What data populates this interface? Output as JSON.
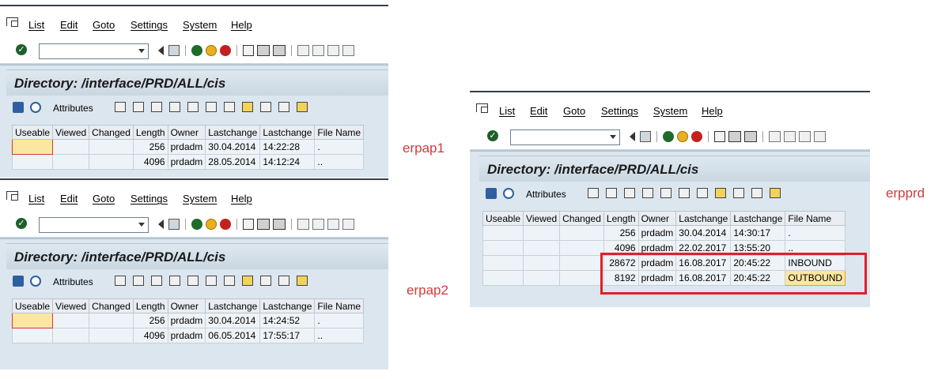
{
  "menu": [
    "List",
    "Edit",
    "Goto",
    "Settings",
    "System",
    "Help"
  ],
  "attributes_label": "Attributes",
  "columns": [
    "Useable",
    "Viewed",
    "Changed",
    "Length",
    "Owner",
    "Lastchange",
    "Lastchange",
    "File Name"
  ],
  "erpap1": {
    "label": "erpap1",
    "title": "Directory: /interface/PRD/ALL/cis",
    "rows": [
      {
        "length": "256",
        "owner": "prdadm",
        "date": "30.04.2014",
        "time": "14:22:28",
        "name": "."
      },
      {
        "length": "4096",
        "owner": "prdadm",
        "date": "28.05.2014",
        "time": "14:12:24",
        "name": ".."
      }
    ]
  },
  "erpap2": {
    "label": "erpap2",
    "title": "Directory: /interface/PRD/ALL/cis",
    "rows": [
      {
        "length": "256",
        "owner": "prdadm",
        "date": "30.04.2014",
        "time": "14:24:52",
        "name": "."
      },
      {
        "length": "4096",
        "owner": "prdadm",
        "date": "06.05.2014",
        "time": "17:55:17",
        "name": ".."
      }
    ]
  },
  "erpprd": {
    "label": "erpprd",
    "title": "Directory: /interface/PRD/ALL/cis",
    "rows": [
      {
        "length": "256",
        "owner": "prdadm",
        "date": "30.04.2014",
        "time": "14:30:17",
        "name": "."
      },
      {
        "length": "4096",
        "owner": "prdadm",
        "date": "22.02.2017",
        "time": "13:55:20",
        "name": ".."
      },
      {
        "length": "28672",
        "owner": "prdadm",
        "date": "16.08.2017",
        "time": "20:45:22",
        "name": "INBOUND"
      },
      {
        "length": "8192",
        "owner": "prdadm",
        "date": "16.08.2017",
        "time": "20:45:22",
        "name": "OUTBOUND"
      }
    ]
  },
  "colors": {
    "label": "#d43a3a",
    "highlight": "#e0202a",
    "title_bg": "#c9d7e2"
  }
}
